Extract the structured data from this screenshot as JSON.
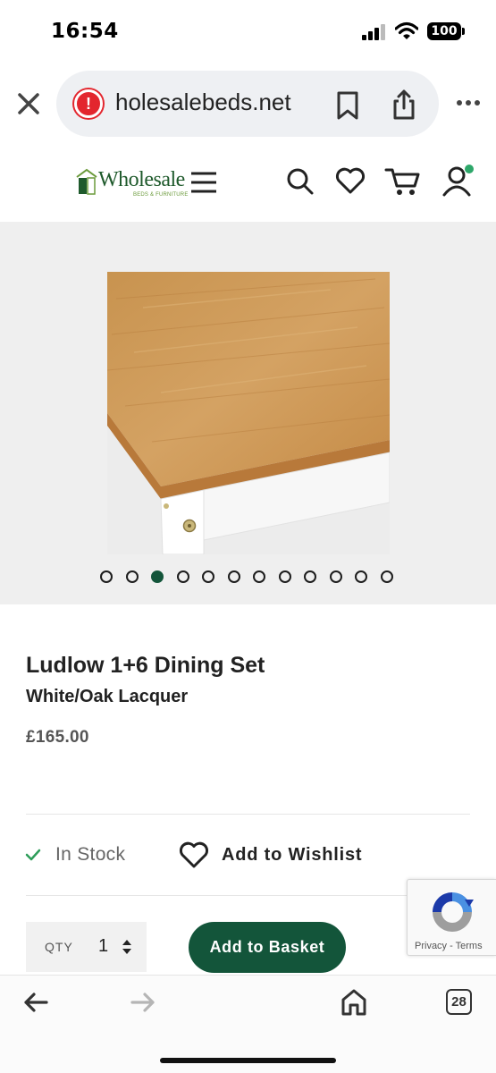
{
  "status_bar": {
    "time": "16:54",
    "battery": "100",
    "icons": [
      "cellular-signal-icon",
      "wifi-icon",
      "battery-icon"
    ]
  },
  "browser": {
    "url": "holesalebeds.net",
    "security_warning_icon": "warning-icon",
    "tab_count": "28",
    "toolbar_icons": [
      "close-icon",
      "bookmark-icon",
      "share-icon",
      "more-icon"
    ],
    "bottom_icons": [
      "back-arrow-icon",
      "forward-arrow-icon",
      "home-icon",
      "tabs-icon"
    ]
  },
  "site": {
    "logo_word": "Wholesale",
    "logo_tagline": "BEDS & FURNITURE",
    "header_icons": [
      "menu-icon",
      "search-icon",
      "heart-icon",
      "cart-icon",
      "user-icon"
    ],
    "accent_color": "#13553a"
  },
  "gallery": {
    "image_count": 12,
    "active_index": 2
  },
  "product": {
    "title": "Ludlow 1+6 Dining Set",
    "subtitle": "White/Oak Lacquer",
    "price": "£165.00",
    "stock_status": "In Stock",
    "wishlist_label": "Add to Wishlist",
    "qty_label": "QTY",
    "qty_value": "1",
    "add_to_basket_label": "Add to Basket"
  },
  "recaptcha": {
    "links": "Privacy - Terms"
  }
}
